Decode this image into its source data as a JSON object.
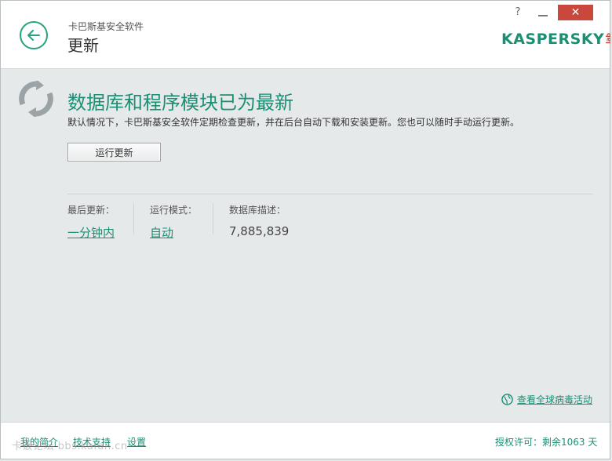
{
  "header": {
    "product_name": "卡巴斯基安全软件",
    "page_title": "更新",
    "help_label": "?",
    "close_label": "✕",
    "logo_text": "KASPERSKY",
    "logo_lab": "lab"
  },
  "status": {
    "title": "数据库和程序模块已为最新",
    "description": "默认情况下，卡巴斯基安全软件定期检查更新，并在后台自动下载和安装更新。您也可以随时手动运行更新。",
    "run_button_label": "运行更新"
  },
  "info": {
    "last_update_label": "最后更新：",
    "last_update_value": "一分钟内",
    "run_mode_label": "运行模式：",
    "run_mode_value": "自动",
    "db_records_label": "数据库描述：",
    "db_records_value": "7,885,839"
  },
  "globe_link": "查看全球病毒活动",
  "footer": {
    "my_profile": "我的简介",
    "support": "技术支持",
    "settings": "设置",
    "license": "授权许可：剩余1063 天"
  },
  "watermark": "卡饭论坛 bbs.kafan.cn",
  "colors": {
    "accent": "#1a8f74",
    "close": "#c9473d",
    "background": "#e6e9ea"
  },
  "icons": [
    "back-arrow-icon",
    "sync-icon",
    "globe-icon",
    "minimize-icon",
    "close-icon",
    "help-icon"
  ]
}
